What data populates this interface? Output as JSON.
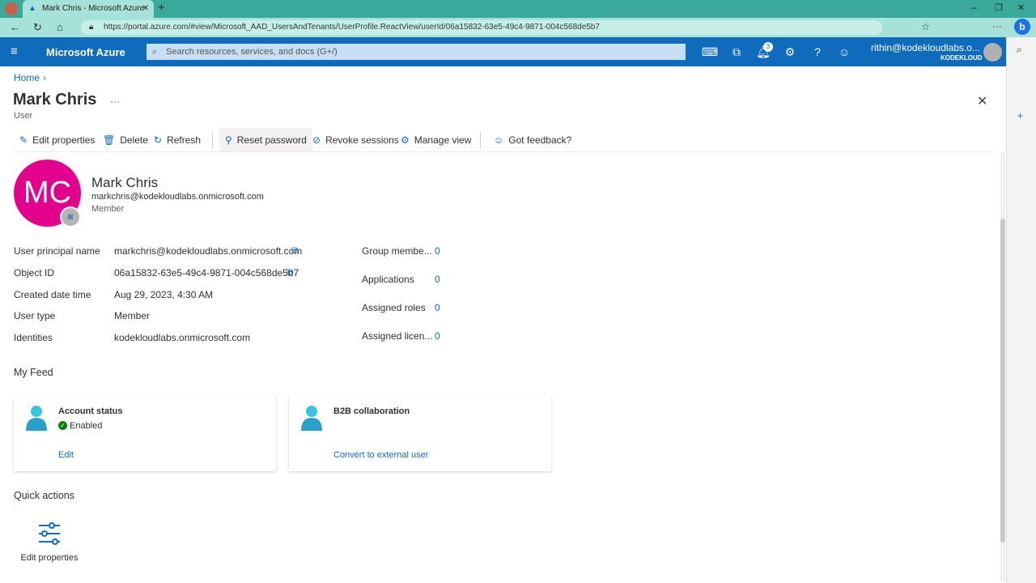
{
  "browser": {
    "tab_title": "Mark Chris - Microsoft Azure",
    "url": "https://portal.azure.com/#view/Microsoft_AAD_UsersAndTenants/UserProfile.ReactView/userId/06a15832-63e5-49c4-9871-004c568de5b7"
  },
  "header": {
    "brand": "Microsoft Azure",
    "search_placeholder": "Search resources, services, and docs (G+/)",
    "notification_count": "3",
    "account": "rithin@kodekloudlabs.o...",
    "tenant": "KODEKLOUD"
  },
  "breadcrumb": {
    "home": "Home"
  },
  "page": {
    "title": "Mark Chris",
    "subtitle": "User",
    "more": "···"
  },
  "toolbar": [
    "Edit properties",
    "Delete",
    "Refresh",
    "Reset password",
    "Revoke sessions",
    "Manage view",
    "Got feedback?"
  ],
  "profile": {
    "initials": "MC",
    "name": "Mark Chris",
    "email": "markchris@kodekloudlabs.onmicrosoft.com",
    "type": "Member",
    "avatar_color": "#e3008c"
  },
  "properties": [
    {
      "label": "User principal name",
      "value": "markchris@kodekloudlabs.onmicrosoft.com"
    },
    {
      "label": "Object ID",
      "value": "06a15832-63e5-49c4-9871-004c568de5b7"
    },
    {
      "label": "Created date time",
      "value": "Aug 29, 2023, 4:30 AM"
    },
    {
      "label": "User type",
      "value": "Member"
    },
    {
      "label": "Identities",
      "value": "kodekloudlabs.onmicrosoft.com"
    }
  ],
  "stats": [
    {
      "label": "Group membe...",
      "value": "0"
    },
    {
      "label": "Applications",
      "value": "0"
    },
    {
      "label": "Assigned roles",
      "value": "0"
    },
    {
      "label": "Assigned licen...",
      "value": "0"
    }
  ],
  "feed": {
    "title": "My Feed",
    "cards": [
      {
        "title": "Account status",
        "status": "Enabled",
        "action": "Edit"
      },
      {
        "title": "B2B collaboration",
        "action": "Convert to external user"
      }
    ]
  },
  "quick_actions": {
    "title": "Quick actions",
    "items": [
      {
        "label": "Edit properties"
      }
    ]
  }
}
